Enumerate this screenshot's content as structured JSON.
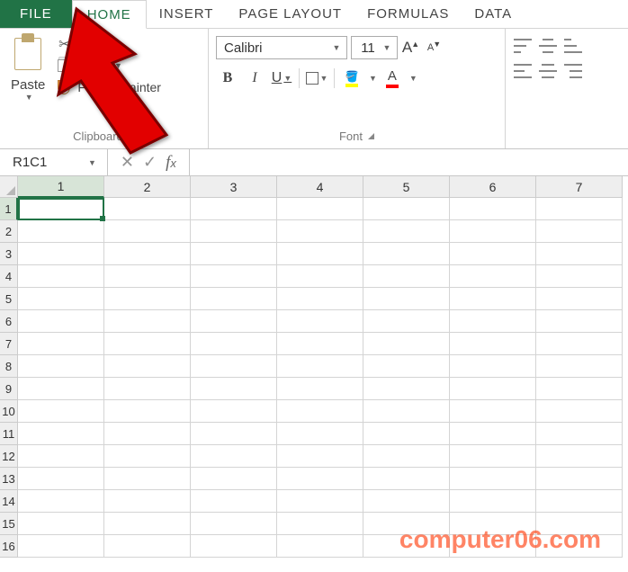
{
  "tabs": {
    "file": "FILE",
    "home": "HOME",
    "insert": "INSERT",
    "page_layout": "PAGE LAYOUT",
    "formulas": "FORMULAS",
    "data": "DATA"
  },
  "clipboard": {
    "paste": "Paste",
    "cut": "Cut",
    "copy": "Copy",
    "format_painter": "Format Painter",
    "group_label": "Clipboard"
  },
  "font": {
    "name": "Calibri",
    "size": "11",
    "bold": "B",
    "italic": "I",
    "underline": "U",
    "font_color_letter": "A",
    "grow_letter": "A",
    "shrink_letter": "A",
    "group_label": "Font"
  },
  "namebox": {
    "value": "R1C1"
  },
  "formula_bar": {
    "value": ""
  },
  "grid": {
    "col_headers": [
      "1",
      "2",
      "3",
      "4",
      "5",
      "6",
      "7"
    ],
    "row_headers": [
      "1",
      "2",
      "3",
      "4",
      "5",
      "6",
      "7",
      "8",
      "9",
      "10",
      "11",
      "12",
      "13",
      "14",
      "15",
      "16"
    ]
  },
  "watermark": "computer06.com"
}
